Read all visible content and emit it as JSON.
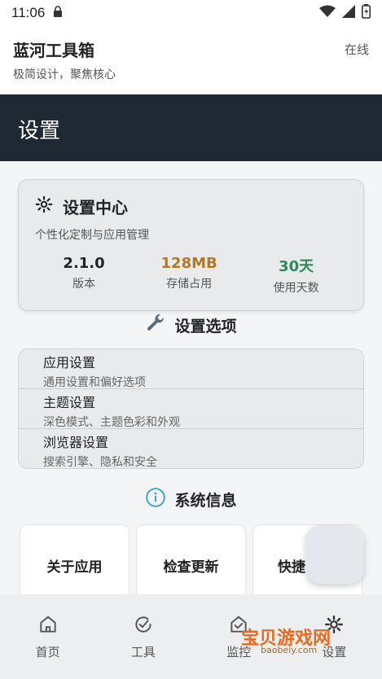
{
  "statusbar": {
    "time": "11:06"
  },
  "header": {
    "title": "蓝河工具箱",
    "subtitle": "极简设计，聚焦核心",
    "status": "在线"
  },
  "page": {
    "title": "设置"
  },
  "settings_card": {
    "title": "设置中心",
    "description": "个性化定制与应用管理",
    "stats": [
      {
        "value": "2.1.0",
        "label": "版本",
        "color": "#1f2328"
      },
      {
        "value": "128MB",
        "label": "存储占用",
        "color": "#b07a22"
      },
      {
        "value": "30天",
        "label": "使用天数",
        "color": "#2d8a5b"
      }
    ]
  },
  "options_section": {
    "title": "设置选项",
    "items": [
      {
        "name": "应用设置",
        "sub": "通用设置和偏好选项"
      },
      {
        "name": "主题设置",
        "sub": "深色模式、主题色彩和外观"
      },
      {
        "name": "浏览器设置",
        "sub": "搜索引擎、隐私和安全"
      }
    ]
  },
  "system_section": {
    "title": "系统信息",
    "tiles": [
      "关于应用",
      "检查更新",
      "快捷"
    ]
  },
  "bottom_nav": [
    {
      "label": "首页",
      "icon": "home-icon"
    },
    {
      "label": "工具",
      "icon": "check-circle-icon"
    },
    {
      "label": "监控",
      "icon": "monitor-icon"
    },
    {
      "label": "设置",
      "icon": "gear-icon"
    }
  ],
  "watermark": {
    "text": "宝贝游戏网",
    "url": "baobeiy.com"
  }
}
